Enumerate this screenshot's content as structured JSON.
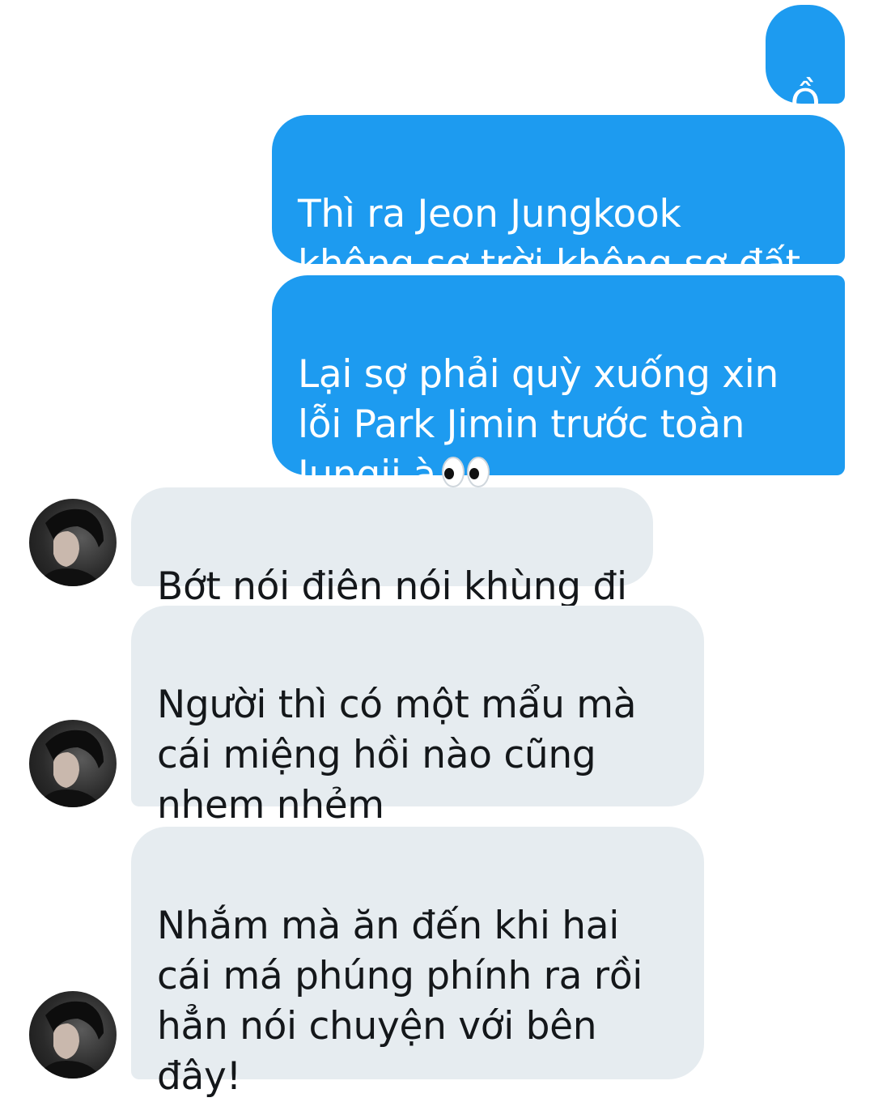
{
  "conversation": {
    "sent": [
      {
        "text": "Ồ"
      },
      {
        "text": "Thì ra Jeon Jungkook\nkhông sợ trời không sợ đất"
      },
      {
        "text": "Lại sợ phải quỳ xuống xin\nlỗi Park Jimin trước toàn\nJungji à"
      }
    ],
    "received": [
      {
        "text": "Bớt nói điên nói khùng đi"
      },
      {
        "text": "Người thì có một mẩu mà\ncái miệng hồi nào cũng\nnhem nhẻm"
      },
      {
        "text": "Nhắm mà ăn đến khi hai\ncái má phúng phính ra rồi\nhẳn nói chuyện với bên\nđây!"
      }
    ]
  },
  "emoji": {
    "eyes": "eyes-emoji"
  },
  "colors": {
    "sent_bubble": "#1d9bf0",
    "received_bubble": "#e6ecf0",
    "sent_text": "#ffffff",
    "received_text": "#14171a"
  }
}
